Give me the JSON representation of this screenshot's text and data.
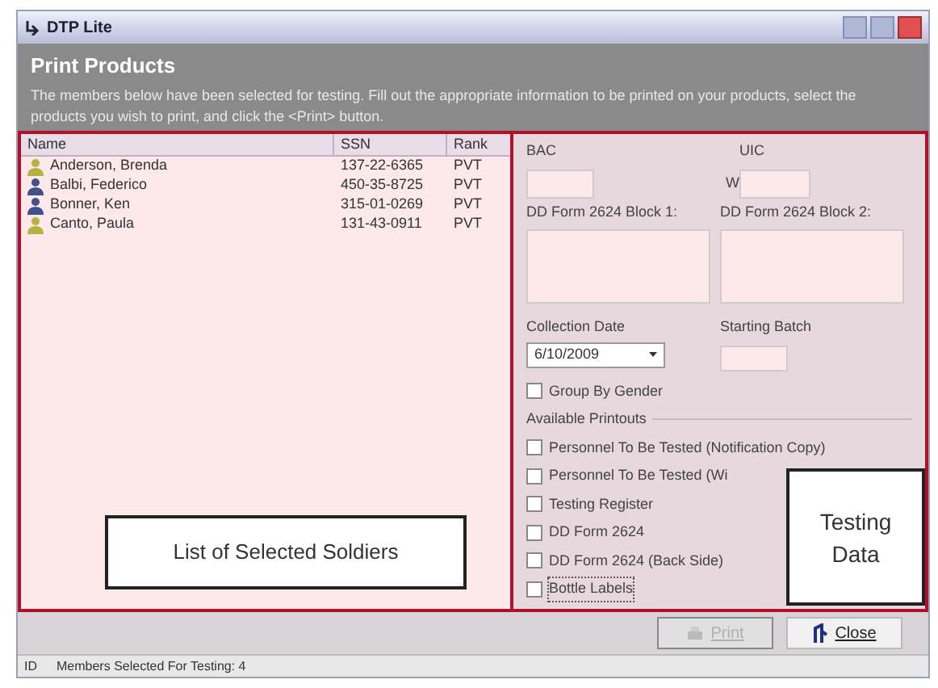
{
  "window": {
    "title": "DTP Lite"
  },
  "header": {
    "title": "Print Products",
    "description": "The members below have been selected for testing. Fill out the appropriate information to be printed on your products, select the products you wish to print, and click the <Print> button."
  },
  "table": {
    "columns": [
      "Name",
      "SSN",
      "Rank"
    ],
    "rows": [
      {
        "name": "Anderson, Brenda",
        "ssn": "137-22-6365",
        "rank": "PVT",
        "color": "#b8b040"
      },
      {
        "name": "Balbi, Federico",
        "ssn": "450-35-8725",
        "rank": "PVT",
        "color": "#40508a"
      },
      {
        "name": "Bonner, Ken",
        "ssn": "315-01-0269",
        "rank": "PVT",
        "color": "#40508a"
      },
      {
        "name": "Canto, Paula",
        "ssn": "131-43-0911",
        "rank": "PVT",
        "color": "#b8b040"
      }
    ]
  },
  "form": {
    "bac_label": "BAC",
    "uic_label": "UIC",
    "uic_prefix": "W",
    "block1_label": "DD Form 2624 Block 1:",
    "block2_label": "DD Form 2624 Block 2:",
    "date_label": "Collection Date",
    "date_value": "6/10/2009",
    "batch_label": "Starting Batch",
    "group_by_gender": {
      "label": "Group By Gender",
      "checked": false
    }
  },
  "printouts": {
    "title": "Available Printouts",
    "items": [
      {
        "label": "Personnel To Be Tested (Notification Copy)",
        "checked": false,
        "focused": false
      },
      {
        "label": "Personnel To Be Tested (Wi",
        "checked": false,
        "focused": false
      },
      {
        "label": "Testing Register",
        "checked": false,
        "focused": false
      },
      {
        "label": "DD Form 2624",
        "checked": false,
        "focused": false
      },
      {
        "label": "DD Form 2624 (Back Side)",
        "checked": false,
        "focused": false
      },
      {
        "label": "Bottle Labels",
        "checked": false,
        "focused": true
      }
    ]
  },
  "callouts": [
    "List of Selected Soldiers",
    "Testing Data"
  ],
  "buttons": [
    {
      "label": "Print",
      "disabled": true
    },
    {
      "label": "Close",
      "disabled": false
    }
  ],
  "status_bar": {
    "id": "ID",
    "message": "Members Selected For Testing: 4"
  }
}
